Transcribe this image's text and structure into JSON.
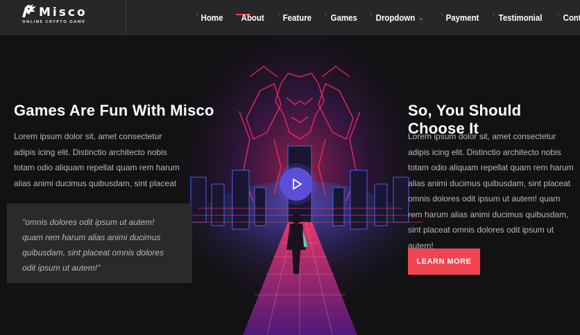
{
  "brand": {
    "name": "Misco",
    "tagline": "ONLINE CRYPTO GAME"
  },
  "nav": {
    "items": [
      {
        "label": "Home"
      },
      {
        "label": "About"
      },
      {
        "label": "Feature"
      },
      {
        "label": "Games"
      },
      {
        "label": "Dropdown"
      },
      {
        "label": "Payment"
      },
      {
        "label": "Testimonial"
      },
      {
        "label": "Contact"
      }
    ],
    "active_index": 1
  },
  "hero": {
    "left_title": "Games Are Fun With Misco",
    "left_text": "Lorem ipsum dolor sit, amet consectetur adipis icing elit. Distinctio architecto nobis totam odio aliquam repellat quam rem harum alias animi ducimus quibusdam, sint placeat",
    "quote": "\"omnis dolores odit ipsum ut autem! quam rem harum alias animi ducimus quibusdam, sint placeat omnis dolores odit ipsum ut autem!\"",
    "right_title": "So, You Should Choose It",
    "right_text": "Lorem ipsum dolor sit, amet consectetur adipis icing elit. Distinctio architecto nobis totam odio aliquam repellat quam rem harum alias animi ducimus quibusdam, sint placeat omnis dolores odit ipsum ut autem! quam rem harum alias animi ducimus quibusdam, sint placeat omnis dolores odit ipsum ut autem!",
    "cta_label": "LEARN MORE"
  },
  "colors": {
    "accent": "#ef4551",
    "play": "#5b4fd6",
    "background": "#121213",
    "header": "#27272a"
  },
  "icons": {
    "logo": "dragon-logo-icon",
    "play": "play-icon",
    "caret": "chevron-down-icon"
  }
}
